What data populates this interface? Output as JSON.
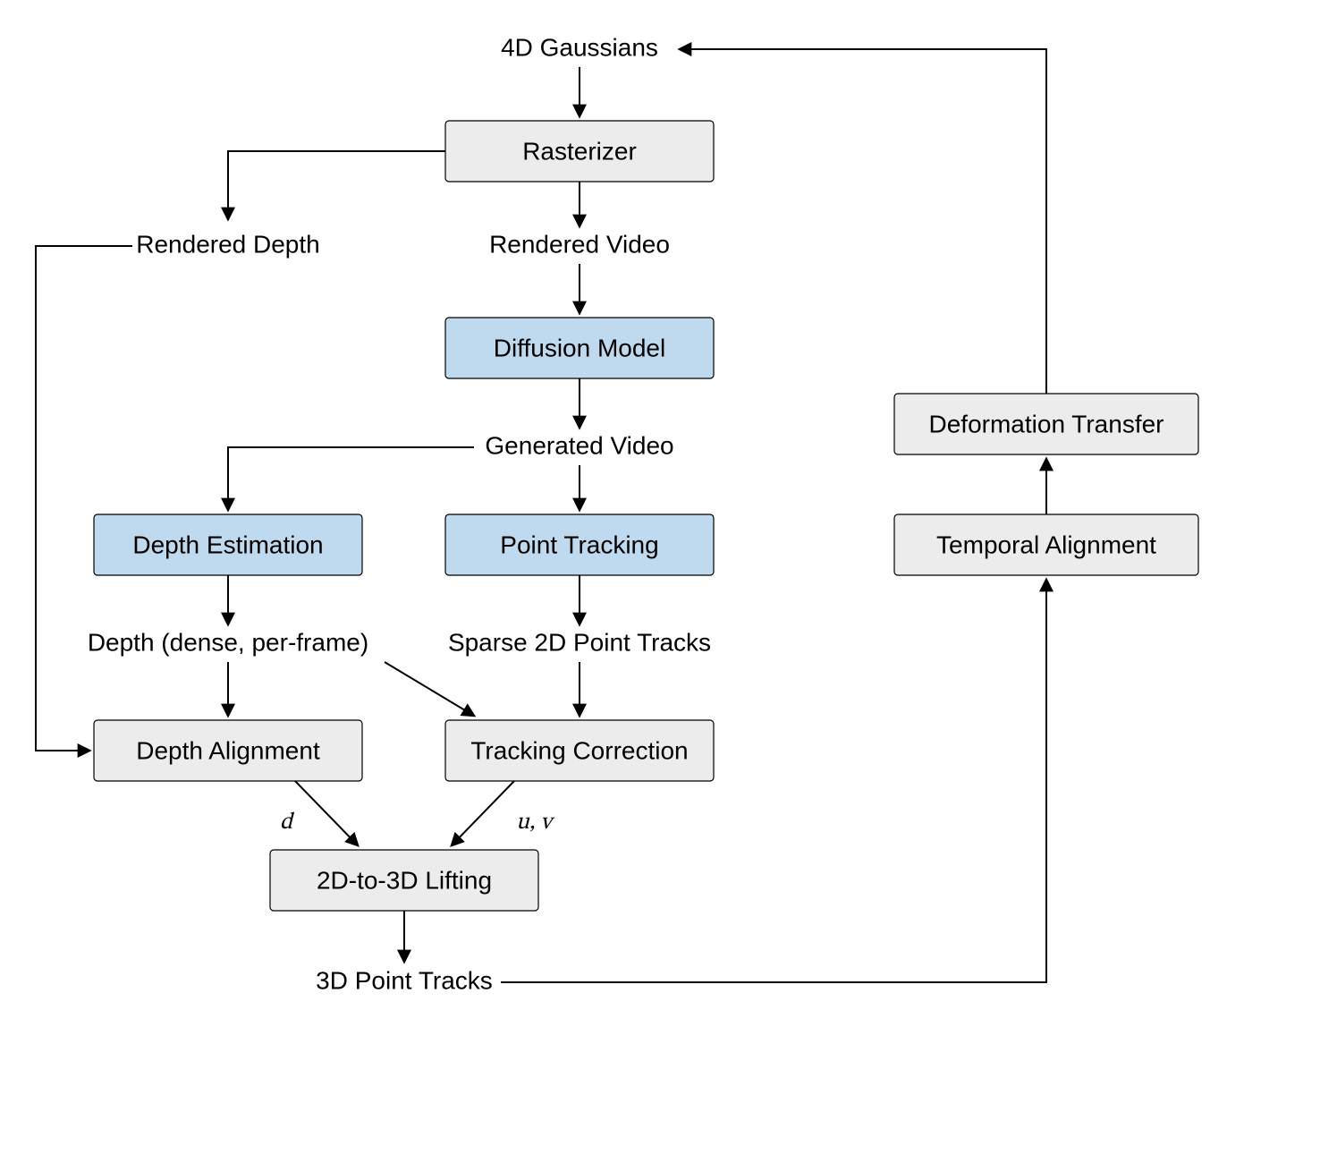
{
  "diagram": {
    "title": "4D Gaussian pipeline flowchart",
    "labels": {
      "gaussians": "4D Gaussians",
      "rasterizer": "Rasterizer",
      "rendered_depth": "Rendered Depth",
      "rendered_video": "Rendered Video",
      "diffusion_model": "Diffusion Model",
      "generated_video": "Generated Video",
      "depth_estimation": "Depth Estimation",
      "point_tracking": "Point Tracking",
      "depth_dense": "Depth (dense, per-frame)",
      "sparse_tracks": "Sparse 2D Point Tracks",
      "depth_alignment": "Depth Alignment",
      "tracking_correction": "Tracking Correction",
      "arrow_d": "d",
      "arrow_uv": "u, v",
      "lifting": "2D-to-3D Lifting",
      "tracks3d": "3D Point Tracks",
      "temporal_alignment": "Temporal Alignment",
      "deformation_transfer": "Deformation Transfer"
    },
    "colors": {
      "box_gray": "#ececec",
      "box_blue": "#bfd9ee",
      "stroke": "#000000",
      "background": "#ffffff"
    }
  }
}
